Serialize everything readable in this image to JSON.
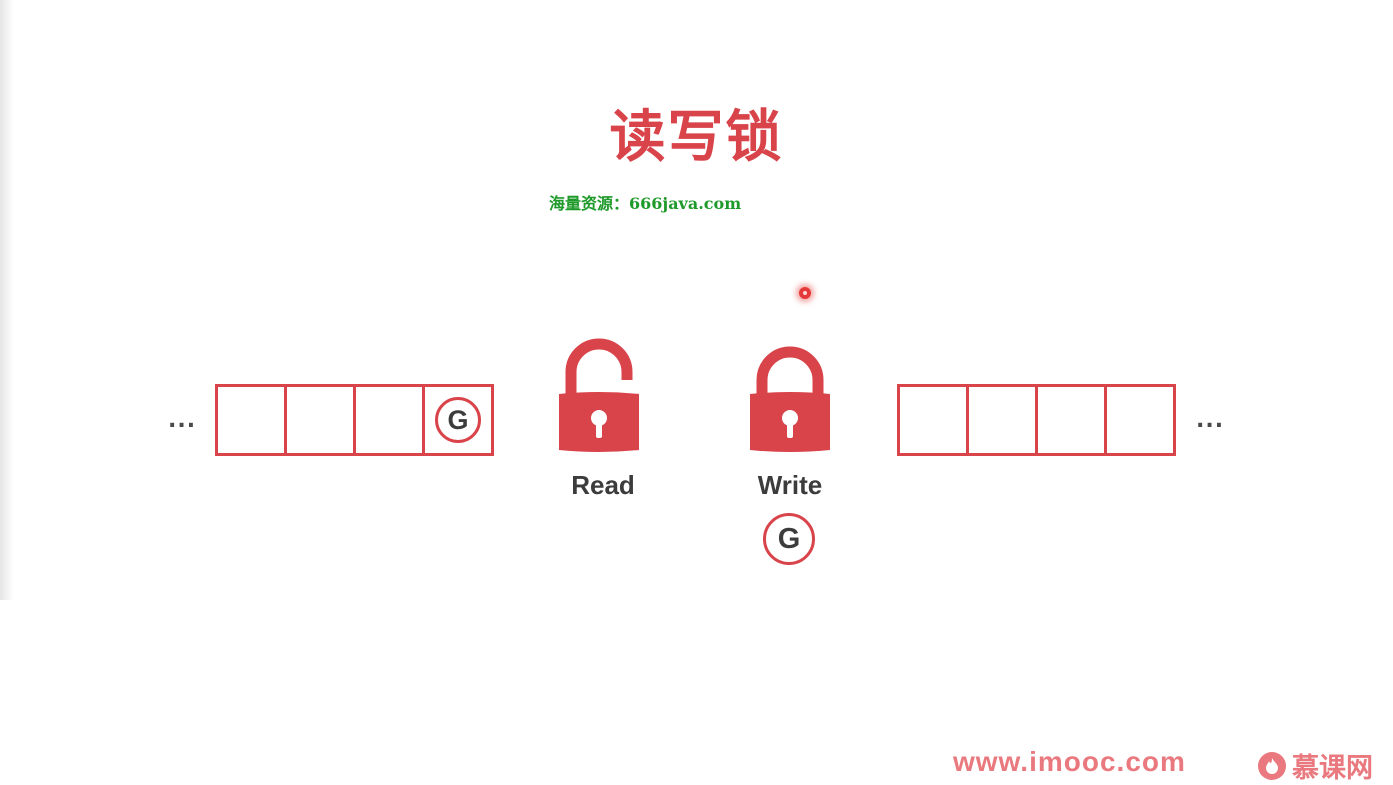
{
  "title": "读写锁",
  "watermark": "海量资源：666java.com",
  "ellipsis": "...",
  "left_queue": {
    "cells": [
      "",
      "",
      "",
      "G"
    ]
  },
  "right_queue": {
    "cells": [
      "",
      "",
      "",
      ""
    ]
  },
  "locks": [
    {
      "label": "Read",
      "state": "unlocked",
      "icon": "open-padlock-icon"
    },
    {
      "label": "Write",
      "state": "locked",
      "icon": "closed-padlock-icon",
      "holder": "G"
    }
  ],
  "footer": {
    "url": "www.imooc.com",
    "brand": "慕课网"
  },
  "colors": {
    "accent": "#d9434a",
    "text": "#3c3c3c",
    "watermark": "#1e9a2a",
    "footer": "#e9797e"
  }
}
